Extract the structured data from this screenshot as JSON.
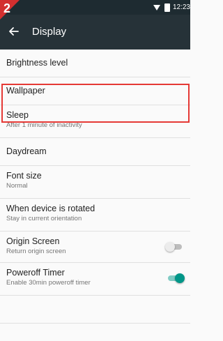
{
  "step_badge": "2",
  "status_bar": {
    "time": "12:23",
    "icons": [
      "wifi-icon",
      "battery-icon"
    ]
  },
  "toolbar": {
    "title": "Display",
    "back_icon": "arrow-back-icon"
  },
  "settings": [
    {
      "title": "Brightness level",
      "summary": ""
    },
    {
      "title": "Wallpaper",
      "summary": ""
    },
    {
      "title": "Sleep",
      "summary": "After 1 minute of inactivity",
      "highlighted": true
    },
    {
      "title": "Daydream",
      "summary": ""
    },
    {
      "title": "Font size",
      "summary": "Normal"
    },
    {
      "title": "When device is rotated",
      "summary": "Stay in current orientation"
    },
    {
      "title": "Origin Screen",
      "summary": "Return origin screen",
      "toggle": "off"
    },
    {
      "title": "Poweroff Timer",
      "summary": "Enable 30min poweroff timer",
      "toggle": "on"
    },
    {
      "title": "",
      "summary": ""
    }
  ],
  "colors": {
    "status_bar": "#1e2b31",
    "toolbar": "#263238",
    "step_badge": "#d32f2f",
    "highlight": "#e53935",
    "toggle_on": "#009688"
  }
}
